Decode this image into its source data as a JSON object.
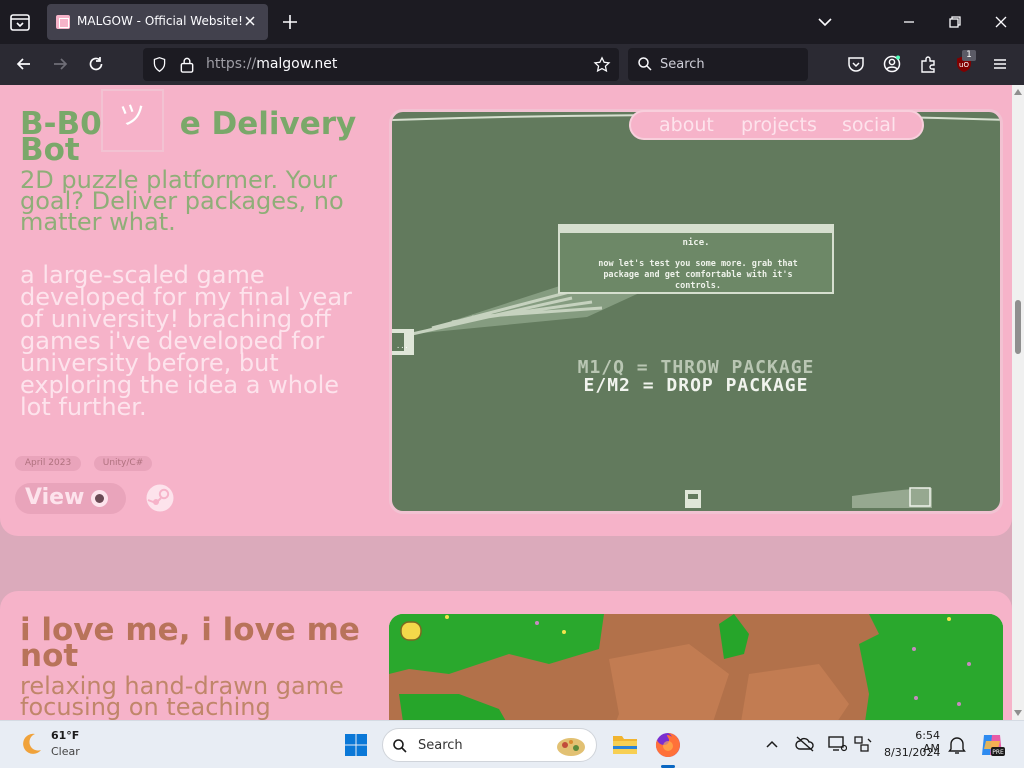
{
  "browser": {
    "tab_title": "MALGOW - Official Website!",
    "url_protocol": "https://",
    "url_host": "malgow.net",
    "search_placeholder": "Search",
    "extension_badge": "1"
  },
  "site_nav": [
    "about",
    "projects",
    "social"
  ],
  "project1": {
    "title_line1": "B-B0",
    "title_line1_rest": "e Delivery",
    "title_line2": "Bot",
    "subtitle": [
      "2D puzzle platformer. Your",
      "goal? Deliver packages, no",
      "matter what."
    ],
    "description": [
      "a large-scaled game",
      "developed for my final year",
      "of university! braching off",
      "games i've developed for",
      "university before, but",
      "exploring the idea a whole",
      "lot further."
    ],
    "tags": [
      "April 2023",
      "Unity/C#"
    ],
    "view_label": "View",
    "logo_glyph": "ツ",
    "game_dialog_title": "nice.",
    "game_dialog_body": [
      "now let's test you some more. grab that",
      "package and get comfortable with it's",
      "controls."
    ],
    "game_controls": [
      "M1/Q = THROW PACKAGE",
      "E/M2 = DROP PACKAGE"
    ],
    "colors": {
      "title": "#7aa86a",
      "subtitle": "#8fae78"
    }
  },
  "project2": {
    "title_line1": "i love me, i love me",
    "title_line2": "not",
    "subtitle": [
      "relaxing hand-drawn game",
      "focusing on teaching"
    ],
    "colors": {
      "title": "#b8735a",
      "subtitle": "#c0866a"
    }
  },
  "taskbar": {
    "weather_temp": "61°F",
    "weather_desc": "Clear",
    "search_label": "Search",
    "time": "6:54 AM",
    "date": "8/31/2024"
  }
}
